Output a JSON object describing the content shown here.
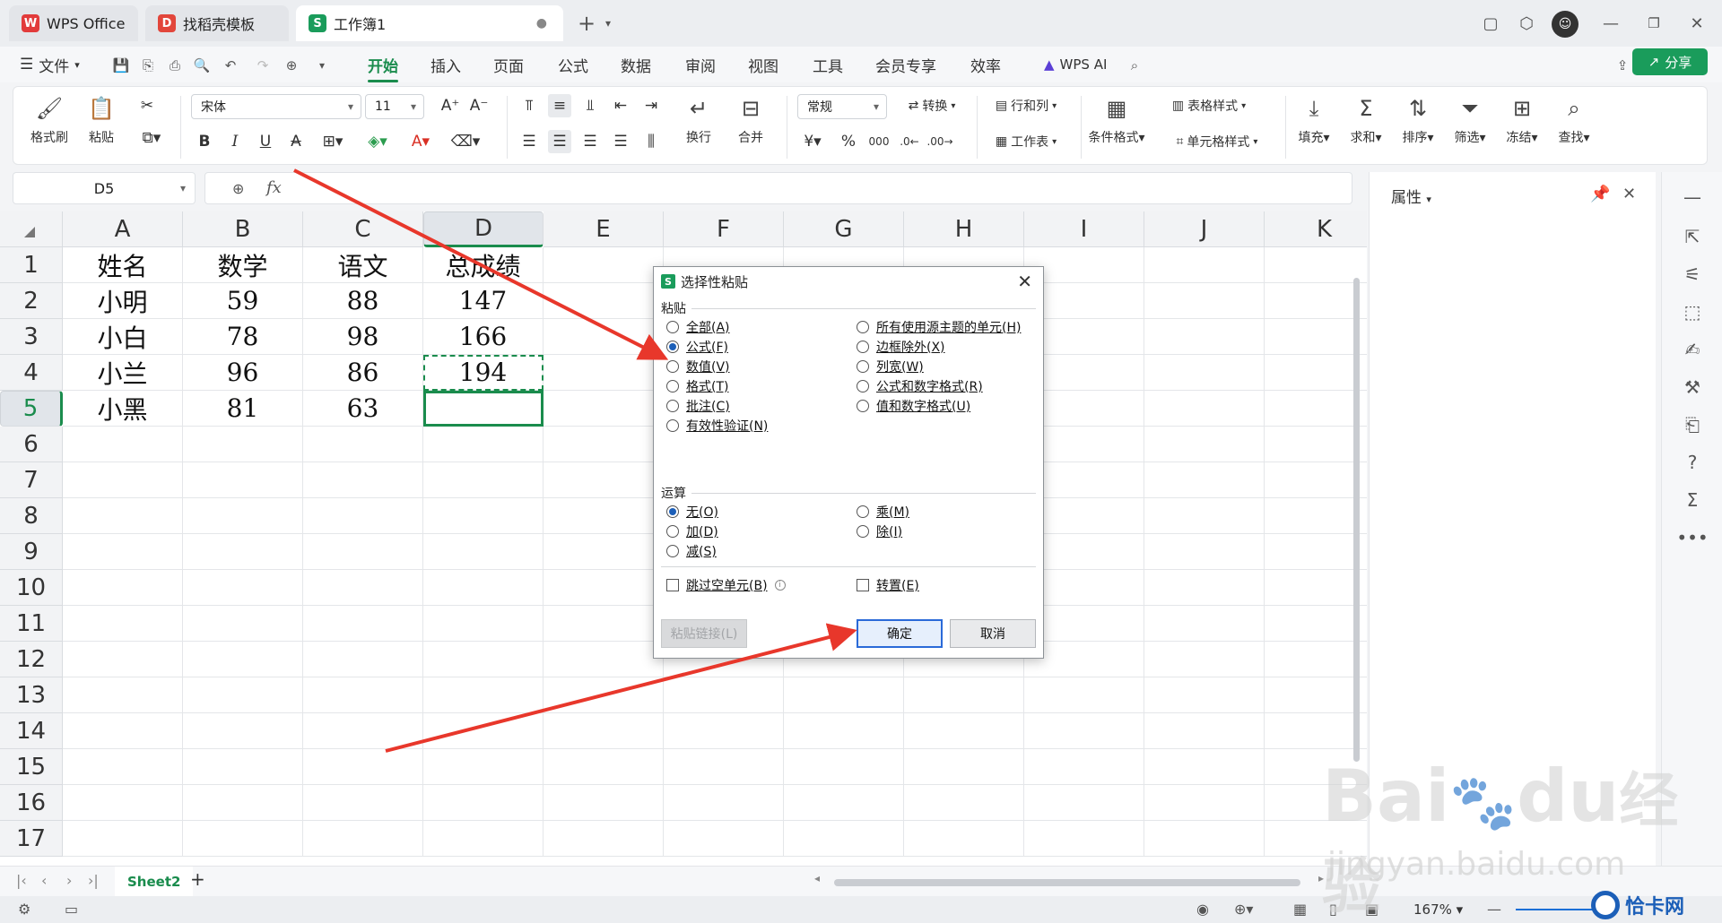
{
  "tabs": [
    {
      "label": "WPS Office",
      "logo": "W"
    },
    {
      "label": "找稻壳模板",
      "logo": "D"
    },
    {
      "label": "工作簿1",
      "logo": "S"
    }
  ],
  "menu": {
    "file": "文件",
    "items": [
      "开始",
      "插入",
      "页面",
      "公式",
      "数据",
      "审阅",
      "视图",
      "工具",
      "会员专享",
      "效率"
    ],
    "active": "开始",
    "wps_ai": "WPS AI",
    "share": "分享"
  },
  "ribbon": {
    "format_painter": "格式刷",
    "paste": "粘贴",
    "font_name": "宋体",
    "font_size": "11",
    "wrap": "换行",
    "merge": "合并",
    "number_format": "常规",
    "convert": "转换",
    "rows_cols": "行和列",
    "worksheet": "工作表",
    "table_style": "表格样式",
    "cond_format": "条件格式",
    "cell_style": "单元格样式",
    "fill": "填充",
    "sum": "求和",
    "sort": "排序",
    "filter": "筛选",
    "freeze": "冻结",
    "find": "查找"
  },
  "formula_bar": {
    "name_box": "D5",
    "fx": "fx",
    "value": ""
  },
  "grid": {
    "columns": [
      "A",
      "B",
      "C",
      "D",
      "E",
      "F",
      "G",
      "H",
      "I",
      "J",
      "K"
    ],
    "selected_column": "D",
    "rows": [
      "1",
      "2",
      "3",
      "4",
      "5",
      "6",
      "7",
      "8",
      "9",
      "10",
      "11",
      "12",
      "13",
      "14",
      "15",
      "16",
      "17"
    ],
    "selected_row": "5",
    "data": [
      [
        "姓名",
        "数学",
        "语文",
        "总成绩"
      ],
      [
        "小明",
        "59",
        "88",
        "147"
      ],
      [
        "小白",
        "78",
        "98",
        "166"
      ],
      [
        "小兰",
        "96",
        "86",
        "194"
      ],
      [
        "小黑",
        "81",
        "63",
        ""
      ]
    ]
  },
  "side_panel": {
    "title": "属性"
  },
  "sheet_tab": "Sheet2",
  "status": {
    "zoom": "167%"
  },
  "dialog": {
    "title": "选择性粘贴",
    "paste_group": "粘贴",
    "paste_left": [
      "全部(A)",
      "公式(F)",
      "数值(V)",
      "格式(T)",
      "批注(C)",
      "有效性验证(N)"
    ],
    "paste_right": [
      "所有使用源主题的单元(H)",
      "边框除外(X)",
      "列宽(W)",
      "公式和数字格式(R)",
      "值和数字格式(U)"
    ],
    "paste_selected": "公式(F)",
    "op_group": "运算",
    "op_left": [
      "无(O)",
      "加(D)",
      "减(S)"
    ],
    "op_right": [
      "乘(M)",
      "除(I)"
    ],
    "op_selected": "无(O)",
    "skip_blanks": "跳过空单元(B)",
    "transpose": "转置(E)",
    "paste_link": "粘贴链接(L)",
    "ok": "确定",
    "cancel": "取消"
  },
  "watermark": {
    "baidu": "Bai",
    "du": "du",
    "jingyan": "经验",
    "url": "jingyan.baidu.com",
    "brand": "恰卡网"
  },
  "colors": {
    "accent": "#1a8c4d",
    "arrow": "#e8372b",
    "dialog_primary": "#2a6ad8"
  }
}
